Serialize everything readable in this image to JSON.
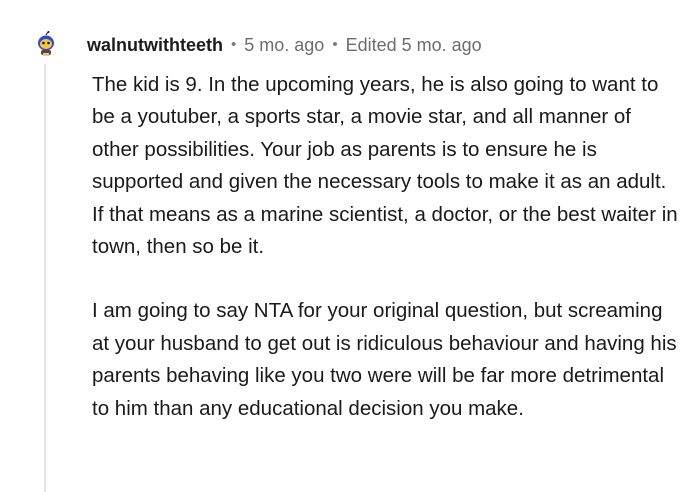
{
  "comment": {
    "username": "walnutwithteeth",
    "separator": "•",
    "posted_time": "5 mo. ago",
    "edited_label": "Edited 5 mo. ago",
    "paragraphs": [
      "The kid is 9. In the upcoming years, he is also going to want to be a youtuber, a sports star, a movie star, and all manner of other possibilities. Your job as parents is to ensure he is supported and given the necessary tools to make it as an adult. If that means as a marine scientist, a doctor, or the best waiter in town, then so be it.",
      "I am going to say NTA for your original question, but screaming at your husband to get out is ridiculous behaviour and having his parents behaving like you two were will be far more detrimental to him than any educational decision you make."
    ],
    "avatar_icon": "snoo-avatar-icon"
  }
}
